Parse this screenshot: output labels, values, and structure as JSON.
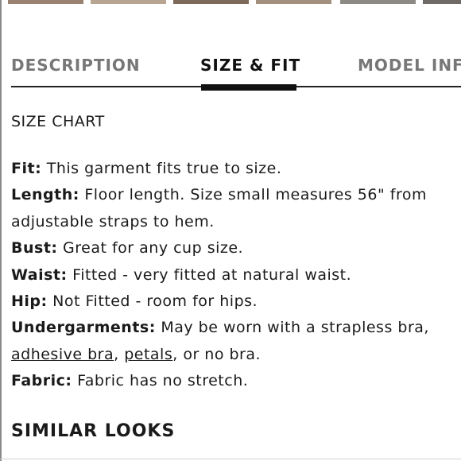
{
  "thumbnail_colors": [
    "#9a8170",
    "#b7a591",
    "#7d6a5a",
    "#a38f7d",
    "#8d8a85",
    "#6f6a66"
  ],
  "tabs": {
    "description": "DESCRIPTION",
    "size_fit": "SIZE & FIT",
    "model_info": "MODEL INF"
  },
  "size_chart_label": "SIZE CHART",
  "details": {
    "fit_label": "Fit:",
    "fit_text": " This garment fits true to size.",
    "length_label": "Length:",
    "length_text_1": " Floor length. Size small measures 56\" from",
    "length_text_2": "adjustable straps to hem.",
    "bust_label": "Bust:",
    "bust_text": " Great for any cup size.",
    "waist_label": "Waist:",
    "waist_text": " Fitted - very fitted at natural waist.",
    "hip_label": "Hip:",
    "hip_text": " Not Fitted - room for hips.",
    "undergarments_label": "Undergarments:",
    "undergarments_text": " May be worn with a strapless bra,",
    "adhesive_bra_link": "adhesive bra",
    "comma_1": ", ",
    "petals_link": "petals",
    "undergarments_end": ", or no bra.",
    "fabric_label": "Fabric:",
    "fabric_text": " Fabric has no stretch."
  },
  "similar_looks": "SIMILAR LOOKS"
}
